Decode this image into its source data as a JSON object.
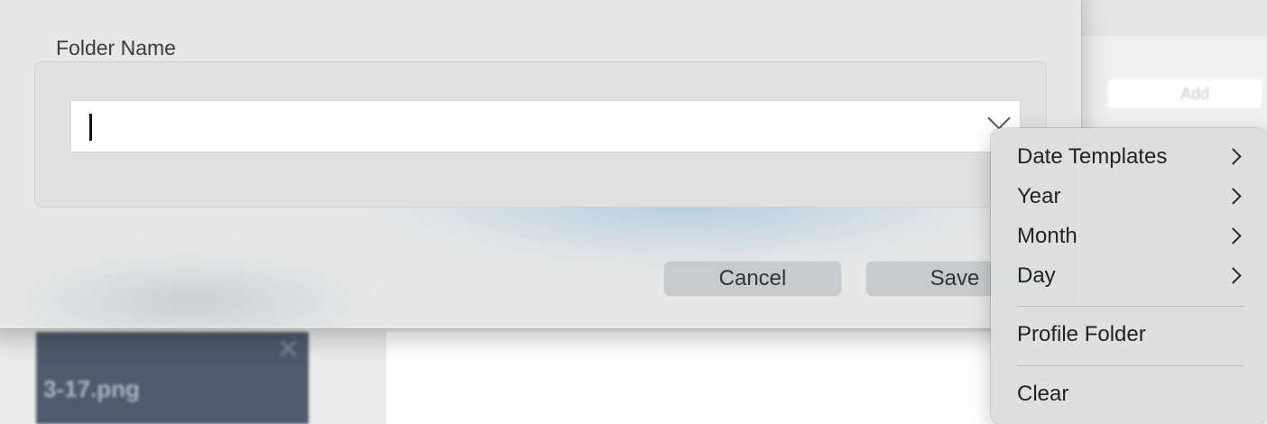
{
  "background": {
    "add_button_label": "Add",
    "thumbnail_filename": "3-17.png"
  },
  "dialog": {
    "folder_name_label": "Folder Name",
    "folder_name_value": "",
    "cancel_label": "Cancel",
    "save_label": "Save"
  },
  "menu": {
    "items": [
      {
        "label": "Date Templates",
        "has_submenu": true
      },
      {
        "label": "Year",
        "has_submenu": true
      },
      {
        "label": "Month",
        "has_submenu": true
      },
      {
        "label": "Day",
        "has_submenu": true
      },
      {
        "label": "Profile Folder",
        "has_submenu": false
      },
      {
        "label": "Clear",
        "has_submenu": false
      }
    ]
  },
  "icons": {
    "combo": "chevron-down-icon",
    "submenu": "chevron-right-icon",
    "thumb_close": "close-icon"
  }
}
